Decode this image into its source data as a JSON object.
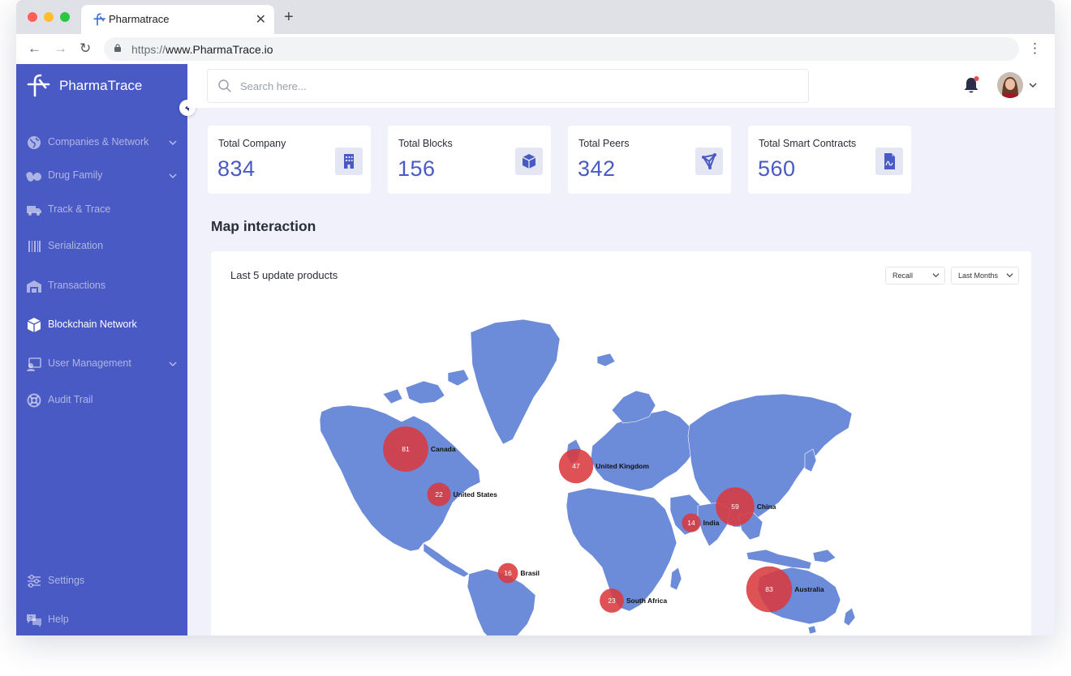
{
  "browser": {
    "tab_title": "Pharmatrace",
    "url_scheme": "https://",
    "url_host": "www.PharmaTrace.io"
  },
  "app": {
    "brand_name": "PharmaTrace",
    "accent_color": "#4a5ac4"
  },
  "sidebar": {
    "items": [
      {
        "label": "Companies & Network",
        "icon": "globe-icon",
        "has_submenu": true,
        "active": false
      },
      {
        "label": "Drug Family",
        "icon": "pills-icon",
        "has_submenu": true,
        "active": false
      },
      {
        "label": "Track & Trace",
        "icon": "truck-icon",
        "has_submenu": false,
        "active": false
      },
      {
        "label": "Serialization",
        "icon": "barcode-icon",
        "has_submenu": false,
        "active": false
      },
      {
        "label": "Transactions",
        "icon": "warehouse-icon",
        "has_submenu": false,
        "active": false
      },
      {
        "label": "Blockchain Network",
        "icon": "cube-icon",
        "has_submenu": false,
        "active": true
      },
      {
        "label": "User Management",
        "icon": "user-card-icon",
        "has_submenu": true,
        "active": false
      },
      {
        "label": "Audit Trail",
        "icon": "lifebuoy-icon",
        "has_submenu": false,
        "active": false
      }
    ],
    "footer_items": [
      {
        "label": "Settings",
        "icon": "sliders-icon"
      },
      {
        "label": "Help",
        "icon": "chat-help-icon"
      }
    ]
  },
  "topbar": {
    "search_placeholder": "Search here...",
    "notification_unread": true
  },
  "stats": [
    {
      "label": "Total Company",
      "value": "834",
      "icon": "building-icon"
    },
    {
      "label": "Total Blocks",
      "value": "156",
      "icon": "cube-icon"
    },
    {
      "label": "Total Peers",
      "value": "342",
      "icon": "network-icon"
    },
    {
      "label": "Total Smart Contracts",
      "value": "560",
      "icon": "contract-icon"
    }
  ],
  "map_section": {
    "title": "Map interaction",
    "card_title": "Last 5 update products",
    "filter_recall": "Recall",
    "filter_period": "Last Months",
    "land_color": "#6c8bd8",
    "bubble_color": "#d93a3e",
    "markers": [
      {
        "country": "Canada",
        "value": 81
      },
      {
        "country": "United States",
        "value": 22
      },
      {
        "country": "United Kingdom",
        "value": 47
      },
      {
        "country": "China",
        "value": 59
      },
      {
        "country": "India",
        "value": 14
      },
      {
        "country": "Brasil",
        "value": 16
      },
      {
        "country": "South Africa",
        "value": 23
      },
      {
        "country": "Australia",
        "value": 83
      }
    ]
  }
}
